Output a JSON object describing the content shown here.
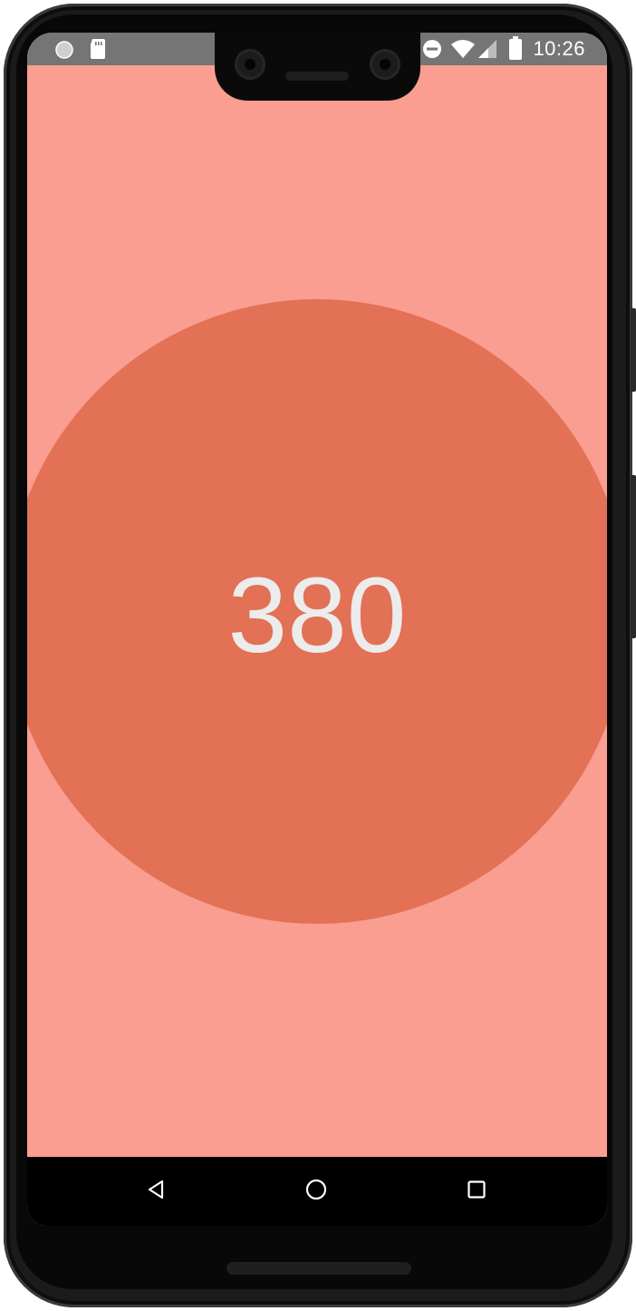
{
  "status_bar": {
    "time": "10:26",
    "left_icons": [
      "notification-dot-icon",
      "sd-card-icon"
    ],
    "right_icons": [
      "do-not-disturb-icon",
      "wifi-icon",
      "signal-icon",
      "battery-icon"
    ]
  },
  "main": {
    "count": "380",
    "colors": {
      "background": "#f99e90",
      "circle": "#e27156",
      "count_text": "#ececec"
    }
  },
  "nav_bar": {
    "buttons": [
      "back-icon",
      "home-icon",
      "recents-icon"
    ]
  }
}
